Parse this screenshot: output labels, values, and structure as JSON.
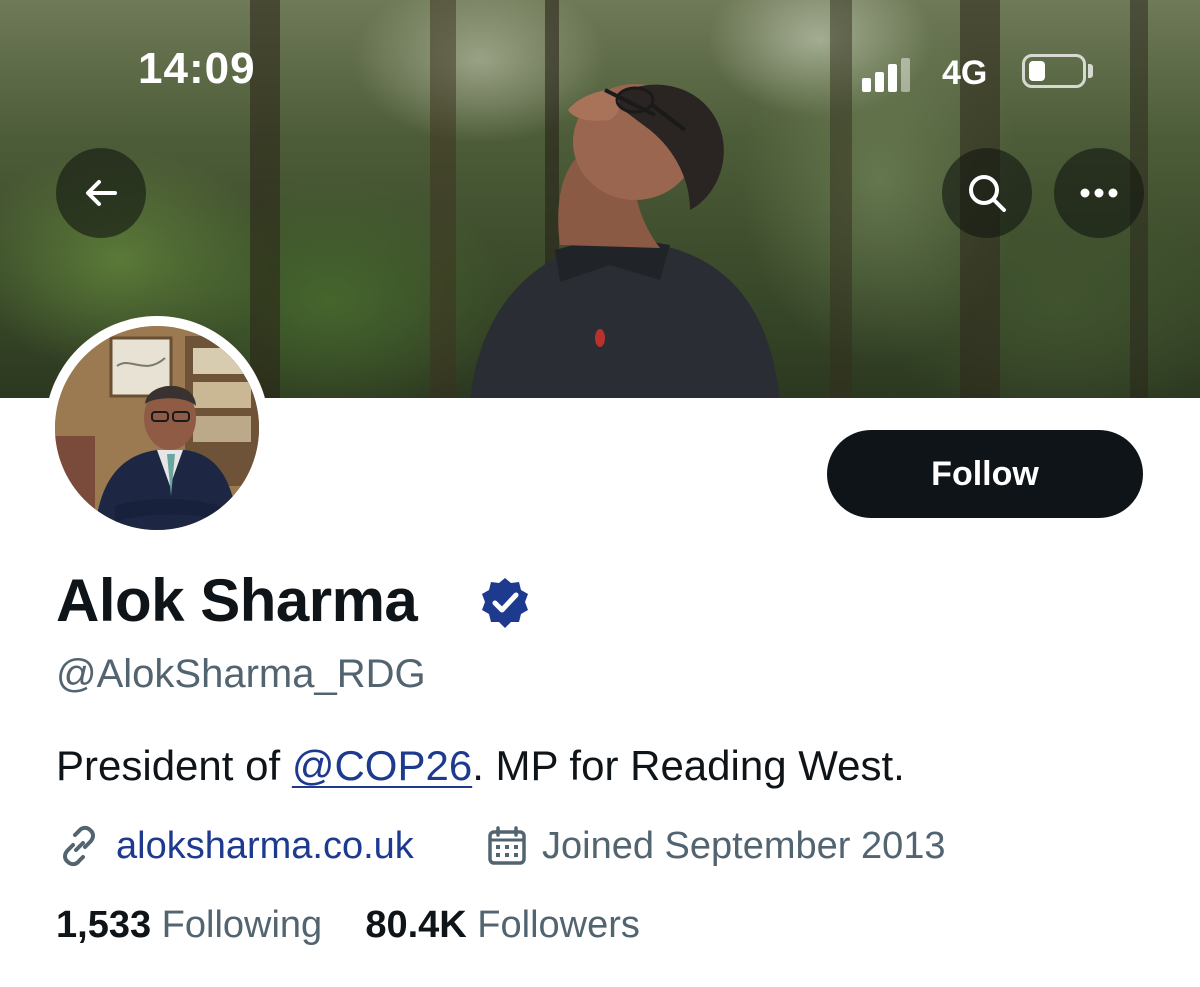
{
  "status_bar": {
    "time": "14:09",
    "network": "4G",
    "battery_level": 0.2,
    "signal_bars": 3
  },
  "header": {
    "back_icon": "arrow-left-icon",
    "search_icon": "search-icon",
    "more_icon": "more-horizontal-icon"
  },
  "profile": {
    "display_name": "Alok Sharma",
    "verified_icon": "verified-badge-icon",
    "handle": "@AlokSharma_RDG",
    "follow_label": "Follow",
    "bio_prefix": "President of ",
    "bio_mention": "@COP26",
    "bio_suffix": ". MP for Reading West.",
    "website": "aloksharma.co.uk",
    "link_icon": "link-icon",
    "calendar_icon": "calendar-icon",
    "joined": "Joined September 2013",
    "following_count": "1,533",
    "following_label": "Following",
    "followers_count": "80.4K",
    "followers_label": "Followers"
  },
  "colors": {
    "text_primary": "#0f1419",
    "text_secondary": "#536471",
    "link": "#1d3a8f",
    "verified": "#1d3a8f",
    "button_bg": "#0f1419"
  }
}
